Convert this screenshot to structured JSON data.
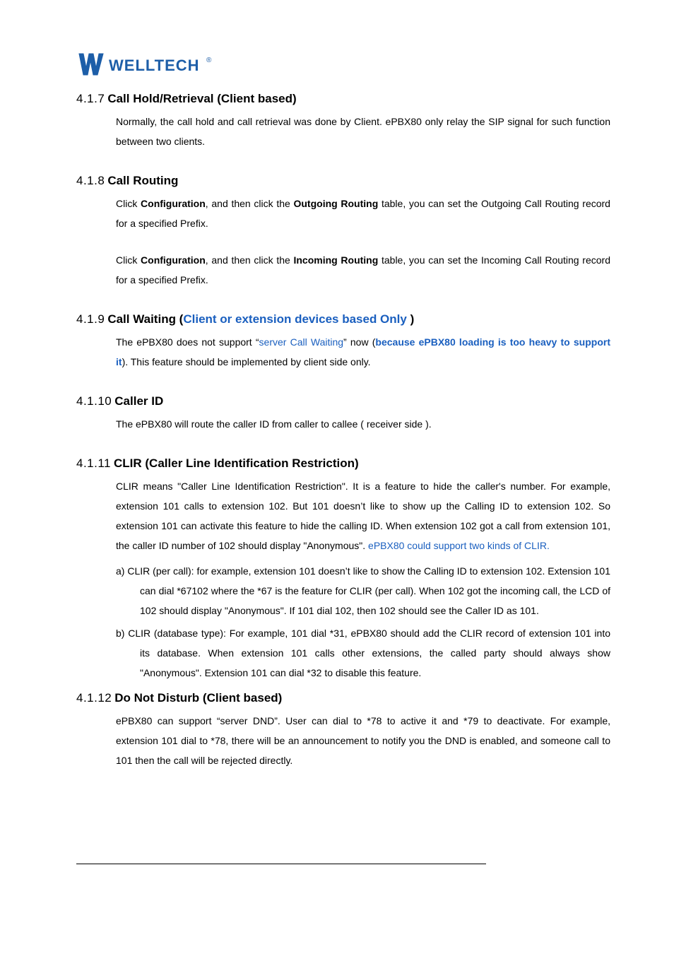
{
  "logo_text": "WELLTECH",
  "sections": [
    {
      "num": "4.1.7",
      "title_parts": [
        {
          "text": "Call Hold/Retrieval (Client based)",
          "cls": ""
        }
      ],
      "paras": [
        {
          "cls": "body-text",
          "runs": [
            {
              "text": "Normally, the call hold and call retrieval was done by Client. ePBX80 only relay the SIP signal for such function between two clients.",
              "cls": ""
            }
          ]
        }
      ]
    },
    {
      "num": "4.1.8",
      "title_parts": [
        {
          "text": "Call Routing",
          "cls": ""
        }
      ],
      "paras": [
        {
          "cls": "body-text",
          "runs": [
            {
              "text": "Click ",
              "cls": ""
            },
            {
              "text": "Configuration",
              "cls": "b"
            },
            {
              "text": ", and then click the ",
              "cls": ""
            },
            {
              "text": "Outgoing Routing",
              "cls": "b"
            },
            {
              "text": " table, you can set the Outgoing Call Routing record for a specified Prefix.",
              "cls": ""
            }
          ]
        },
        {
          "cls": "body-text",
          "runs": [
            {
              "text": "Click ",
              "cls": ""
            },
            {
              "text": "Configuration",
              "cls": "b"
            },
            {
              "text": ", and then click the ",
              "cls": ""
            },
            {
              "text": "Incoming Routing",
              "cls": "b"
            },
            {
              "text": " table, you can set the Incoming Call Routing record for a specified Prefix.",
              "cls": ""
            }
          ]
        }
      ]
    },
    {
      "num": "4.1.9",
      "title_parts": [
        {
          "text": "Call Waiting (",
          "cls": ""
        },
        {
          "text": "Client or extension devices based Only ",
          "cls": "blue-bold"
        },
        {
          "text": ")",
          "cls": ""
        }
      ],
      "paras": [
        {
          "cls": "body-text",
          "runs": [
            {
              "text": "The ePBX80 does not support “",
              "cls": ""
            },
            {
              "text": "server Call Waiting",
              "cls": "blue"
            },
            {
              "text": "” now (",
              "cls": ""
            },
            {
              "text": "because ePBX80 loading is too heavy to support it",
              "cls": "blue-bold"
            },
            {
              "text": "). This feature should be implemented by client side only.",
              "cls": ""
            }
          ]
        }
      ]
    },
    {
      "num": "4.1.10 ",
      "title_parts": [
        {
          "text": "Caller ID",
          "cls": ""
        }
      ],
      "paras": [
        {
          "cls": "body-text",
          "runs": [
            {
              "text": "The ePBX80 will route the caller ID from caller to callee ( receiver side ).",
              "cls": ""
            }
          ]
        }
      ]
    },
    {
      "num": "4.1.11 ",
      "title_parts": [
        {
          "text": "CLIR (Caller Line Identification Restriction)",
          "cls": ""
        }
      ],
      "paras": [
        {
          "cls": "body-text noindent-bottom",
          "runs": [
            {
              "text": "CLIR means \"Caller Line Identification Restriction\". It is a feature to hide the caller's number. For example, extension 101 calls to extension 102. But 101 doesn’t like to show up the Calling ID to extension 102. So extension 101 can activate this feature to hide the calling ID. When extension 102 got a call from extension 101, the caller ID number of 102 should display \"Anonymous\". ",
              "cls": ""
            },
            {
              "text": "ePBX80 could support two kinds of CLIR.",
              "cls": "blue"
            }
          ]
        },
        {
          "cls": "list-item li-hang",
          "runs": [
            {
              "text": "a) CLIR (per call): for example, extension 101 doesn’t like to show the Calling ID to extension 102. Extension 101 can dial *67102 where the *67 is the feature for CLIR (per call). When 102 got the incoming call, the LCD of 102 should display \"Anonymous\". If 101 dial 102, then 102 should see the Caller ID as 101.",
              "cls": ""
            }
          ]
        },
        {
          "cls": "list-item li-hang",
          "runs": [
            {
              "text": "b) CLIR (database type): For example, 101 dial *31, ePBX80 should add the CLIR record of extension 101 into its database. When extension 101 calls other extensions, the called party should always show \"Anonymous\". Extension 101 can dial *32 to disable this feature.",
              "cls": ""
            }
          ]
        }
      ]
    },
    {
      "num": "4.1.12 ",
      "title_parts": [
        {
          "text": "Do Not Disturb (Client based)",
          "cls": ""
        }
      ],
      "paras": [
        {
          "cls": "body-text",
          "runs": [
            {
              "text": "ePBX80 can support “server DND”. User can dial to *78 to active it and *79 to deactivate. For example, extension 101 dial to *78, there will be an announcement to notify you the DND is enabled, and someone call to 101 then the call will be rejected directly.",
              "cls": ""
            }
          ]
        }
      ]
    }
  ]
}
